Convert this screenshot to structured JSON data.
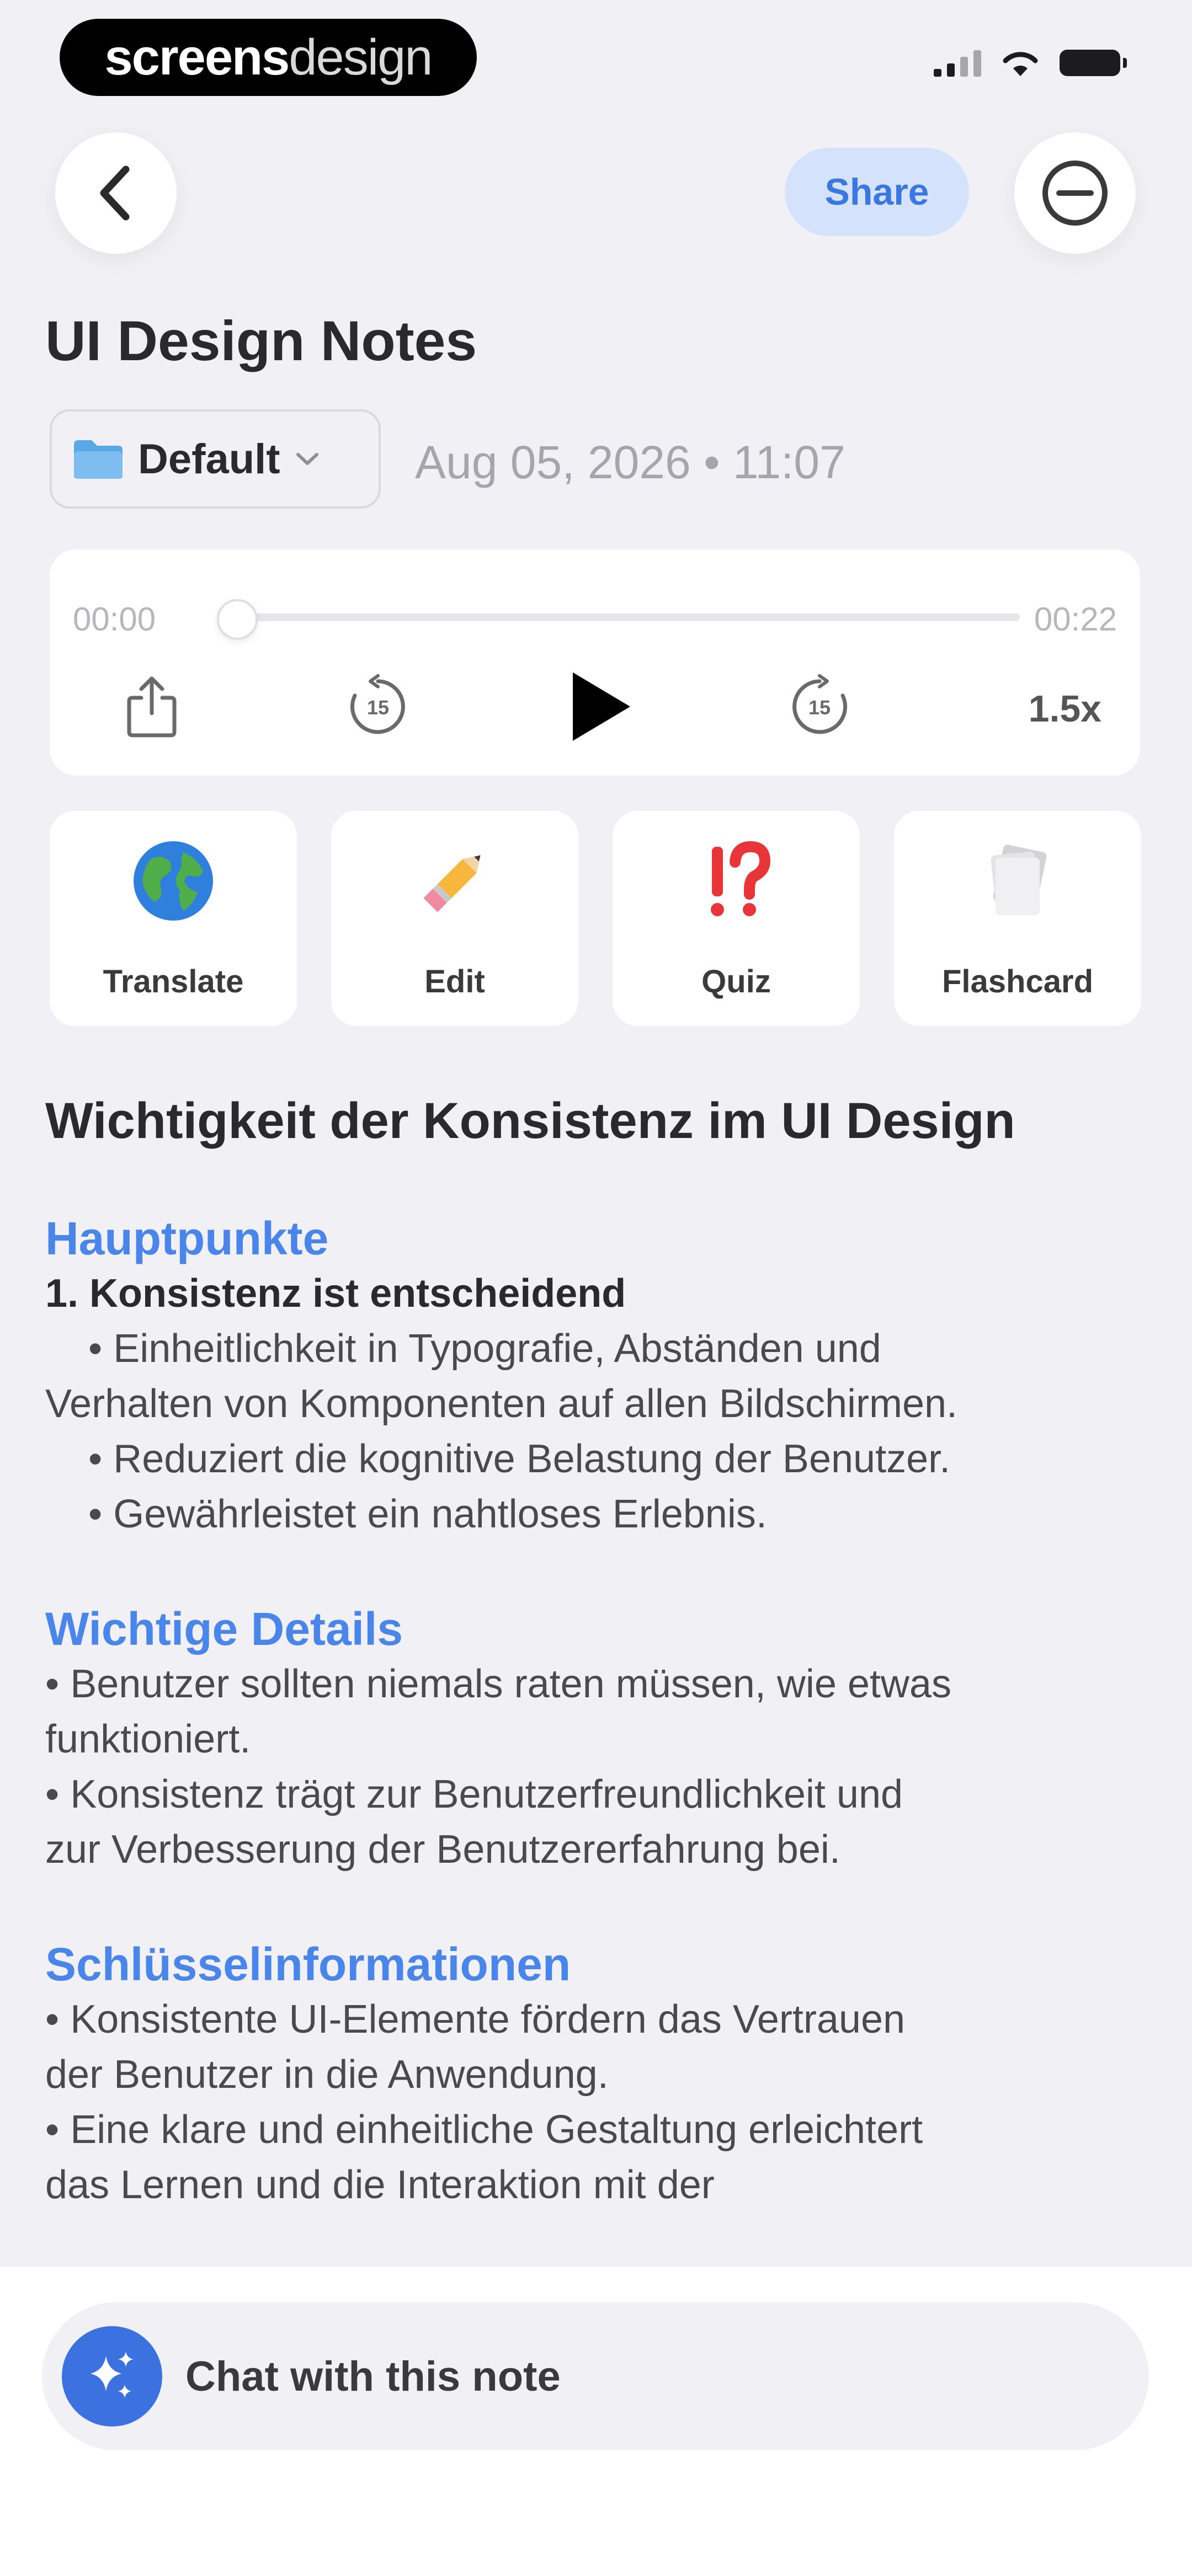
{
  "status_bar": {
    "brand_bold": "screens",
    "brand_light": "design"
  },
  "header": {
    "share_label": "Share",
    "title": "UI Design Notes",
    "folder": "Default",
    "date": "Aug 05, 2026 • 11:07"
  },
  "player": {
    "time_current": "00:00",
    "time_total": "00:22",
    "progress": 0.0,
    "skip_seconds": "15",
    "speed": "1.5x"
  },
  "actions": [
    {
      "label": "Translate",
      "icon": "globe-icon"
    },
    {
      "label": "Edit",
      "icon": "pencil-icon"
    },
    {
      "label": "Quiz",
      "icon": "interrobang-icon"
    },
    {
      "label": "Flashcard",
      "icon": "cards-icon"
    }
  ],
  "note": {
    "heading": "Wichtigkeit der Konsistenz im UI Design",
    "sections": [
      {
        "title": "Hauptpunkte",
        "lines": [
          "1. Konsistenz ist entscheidend",
          "• Einheitlichkeit in Typografie, Abständen und",
          "Verhalten von Komponenten auf allen Bildschirmen.",
          "• Reduziert die kognitive Belastung der Benutzer.",
          "• Gewährleistet ein nahtloses Erlebnis."
        ]
      },
      {
        "title": "Wichtige Details",
        "lines": [
          "• Benutzer sollten niemals raten müssen, wie etwas",
          "funktioniert.",
          "• Konsistenz trägt zur Benutzerfreundlichkeit und",
          "zur Verbesserung der Benutzererfahrung bei."
        ]
      },
      {
        "title": "Schlüsselinformationen",
        "lines": [
          "• Konsistente UI-Elemente fördern das Vertrauen",
          "der Benutzer in die Anwendung.",
          "• Eine klare und einheitliche Gestaltung erleichtert",
          "das Lernen und die Interaktion mit der"
        ]
      }
    ]
  },
  "chat": {
    "label": "Chat with this note"
  },
  "colors": {
    "accent": "#3b72e0",
    "section_title": "#4a85ea",
    "share_bg": "#d4e3fb",
    "background": "#f1f1f5"
  }
}
